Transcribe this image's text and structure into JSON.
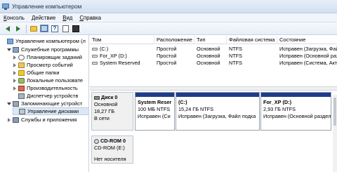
{
  "window": {
    "title": "Управление компьютером"
  },
  "menu": [
    {
      "label": "Консоль",
      "key": "К",
      "rest": "онсоль"
    },
    {
      "label": "Действие",
      "key": "Д",
      "rest": "ействие"
    },
    {
      "label": "Вид",
      "key": "В",
      "rest": "ид"
    },
    {
      "label": "Справка",
      "key": "С",
      "rest": "правка"
    }
  ],
  "toolbar": {
    "icons": [
      "back-arrow-icon",
      "forward-arrow-icon",
      "up-folder-icon",
      "show-hide-console-tree-icon",
      "help-icon",
      "properties-icon",
      "export-icon"
    ]
  },
  "tree": {
    "root": "Управление компьютером (л",
    "items": [
      {
        "label": "Служебные программы",
        "icon": "tools-icon",
        "expanded": true
      },
      {
        "label": "Планировщик заданий",
        "icon": "clock-icon",
        "expanded": false
      },
      {
        "label": "Просмотр событий",
        "icon": "event-icon",
        "expanded": false
      },
      {
        "label": "Общие папки",
        "icon": "share-icon",
        "expanded": false
      },
      {
        "label": "Локальные пользовате",
        "icon": "users-icon",
        "expanded": false
      },
      {
        "label": "Производительность",
        "icon": "perf-icon",
        "expanded": false
      },
      {
        "label": "Диспетчер устройств",
        "icon": "devmgr-icon",
        "expanded": false
      },
      {
        "label": "Запоминающие устройст",
        "icon": "storage-icon",
        "expanded": true
      },
      {
        "label": "Управление дисками",
        "icon": "disk-icon",
        "selected": true
      },
      {
        "label": "Службы и приложения",
        "icon": "services-icon",
        "expanded": false
      }
    ]
  },
  "volumes": {
    "headers": [
      "Том",
      "Расположение",
      "Тип",
      "Файловая система",
      "Состояние"
    ],
    "rows": [
      {
        "name": "(C:)",
        "layout": "Простой",
        "type": "Основной",
        "fs": "NTFS",
        "status": "Исправен (Загрузка, Файл подк"
      },
      {
        "name": "For_XP (D:)",
        "layout": "Простой",
        "type": "Основной",
        "fs": "NTFS",
        "status": "Исправен (Основной раздел)"
      },
      {
        "name": "System Reserved",
        "layout": "Простой",
        "type": "Основной",
        "fs": "NTFS",
        "status": "Исправен (Система, Активен, О"
      }
    ]
  },
  "disks": [
    {
      "name": "Диск 0",
      "kind": "Основной",
      "size": "18,27 ГБ",
      "state": "В сети",
      "partitions": [
        {
          "name": "System Reser",
          "info": "100 МБ NTFS",
          "status": "Исправен (Си"
        },
        {
          "name": "(C:)",
          "info": "15,24 ГБ NTFS",
          "status": "Исправен (Загрузка, Файл подка"
        },
        {
          "name": "For_XP  (D:)",
          "info": "2,93 ГБ NTFS",
          "status": "Исправен (Основной раздел)"
        }
      ]
    },
    {
      "name": "CD-ROM 0",
      "kind": "CD-ROM (E:)",
      "state": "Нет носителя"
    }
  ]
}
